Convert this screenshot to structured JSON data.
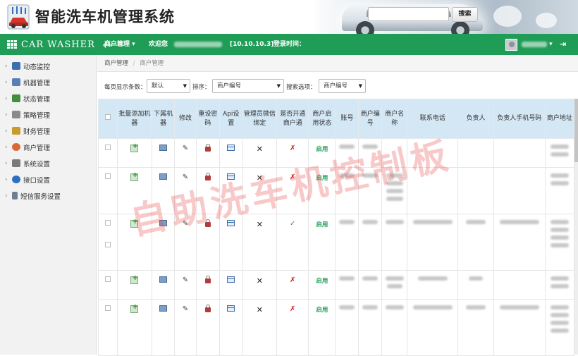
{
  "header": {
    "title": "智能洗车机管理系统"
  },
  "navbar": {
    "brand": "CAR WASHER",
    "back_arrow": "🡐",
    "menu_label": "商户管理",
    "menu_caret": "▾",
    "welcome_label": "欢迎您",
    "ip": "[10.10.10.3]",
    "login_time_label": "登录时间：",
    "exit_icon": "⇥"
  },
  "sidebar": {
    "items": [
      {
        "label": "动态监控",
        "icon": "monitor-icon",
        "color": "#3b6fb0"
      },
      {
        "label": "机器管理",
        "icon": "machine-icon",
        "color": "#5a7fb5"
      },
      {
        "label": "状态管理",
        "icon": "status-icon",
        "color": "#3f8f3f"
      },
      {
        "label": "策略管理",
        "icon": "strategy-icon",
        "color": "#8a8a8a"
      },
      {
        "label": "财务管理",
        "icon": "finance-icon",
        "color": "#c89b2c"
      },
      {
        "label": "商户管理",
        "icon": "merchant-icon",
        "color": "#d86a3a"
      },
      {
        "label": "系统设置",
        "icon": "settings-icon",
        "color": "#7a7a7a"
      },
      {
        "label": "接口设置",
        "icon": "interface-icon",
        "color": "#2f6fbf"
      },
      {
        "label": "短信服务设置",
        "icon": "sms-icon",
        "color": "#6f7f90"
      }
    ]
  },
  "breadcrumb": {
    "home": "商户管理",
    "separator": "/",
    "current": "商户管理"
  },
  "toolbar": {
    "page_size_label": "每页显示条数：",
    "page_size_value": "默认",
    "sort_label": "排序：",
    "sort_value": "商户编号",
    "search_option_label": "搜索选项：",
    "search_option_value": "商户编号",
    "search_button": "搜索"
  },
  "table": {
    "headers": [
      "",
      "批量添加机器",
      "下属机器",
      "修改",
      "重设密码",
      "Api设置",
      "管理员微信绑定",
      "是否开通商户通",
      "商户启用状态",
      "账号",
      "商户编号",
      "商户名称",
      "联系电话",
      "负责人",
      "负责人手机号码",
      "商户地址"
    ],
    "rows": [
      {
        "wechat": "✕",
        "merchant_pass": "✗",
        "status": "启用"
      },
      {
        "wechat": "✕",
        "merchant_pass": "✗",
        "status": "启用"
      },
      {
        "wechat": "✕",
        "merchant_pass": "✓",
        "status": "启用"
      },
      {
        "wechat": "✕",
        "merchant_pass": "✗",
        "status": "启用"
      },
      {
        "wechat": "✕",
        "merchant_pass": "✗",
        "status": "启用"
      }
    ]
  },
  "watermark": "自助洗车机控制板",
  "colors": {
    "nav_green": "#1f9d56",
    "table_header": "#d3e7f5",
    "status_green": "#1f9d56",
    "alert_red": "#d01919"
  }
}
